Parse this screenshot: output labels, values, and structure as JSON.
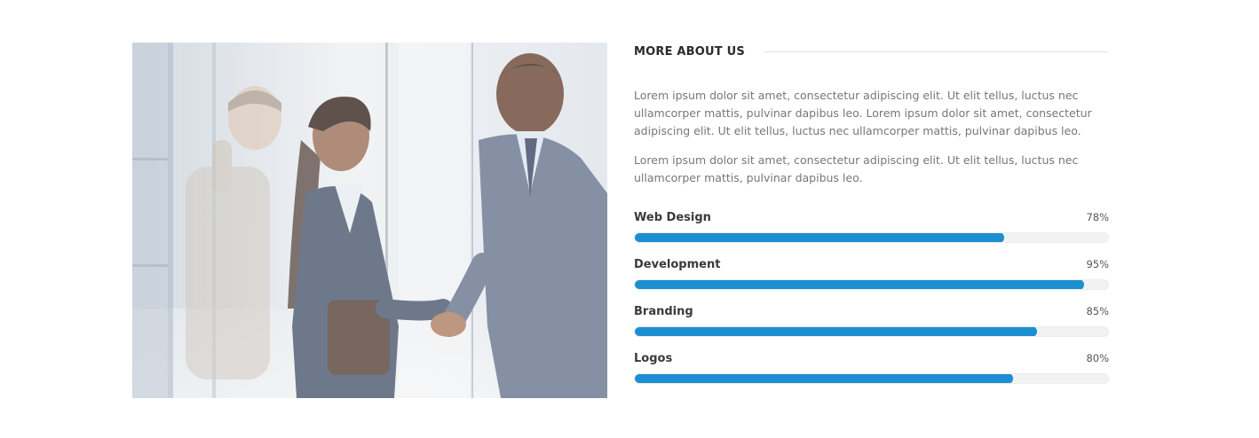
{
  "about": {
    "heading": "MORE ABOUT US",
    "paragraphs": [
      "Lorem ipsum dolor sit amet, consectetur adipiscing elit. Ut elit tellus, luctus nec ullamcorper mattis, pulvinar dapibus leo. Lorem ipsum dolor sit amet, consectetur adipiscing elit. Ut elit tellus, luctus nec ullamcorper mattis, pulvinar dapibus leo.",
      "Lorem ipsum dolor sit amet, consectetur adipiscing elit. Ut elit tellus, luctus nec ullamcorper mattis, pulvinar dapibus leo."
    ]
  },
  "photo": {
    "subject": "business-people-handshake-photo"
  },
  "skills": [
    {
      "name": "Web Design",
      "percent_label": "78%",
      "value": 78
    },
    {
      "name": "Development",
      "percent_label": "95%",
      "value": 95
    },
    {
      "name": "Branding",
      "percent_label": "85%",
      "value": 85
    },
    {
      "name": "Logos",
      "percent_label": "80%",
      "value": 80
    }
  ],
  "colors": {
    "bar_fill": "#1c8fd0",
    "bar_track": "#f1f2f3",
    "heading": "#2b2b2b",
    "body_text": "#777777"
  }
}
